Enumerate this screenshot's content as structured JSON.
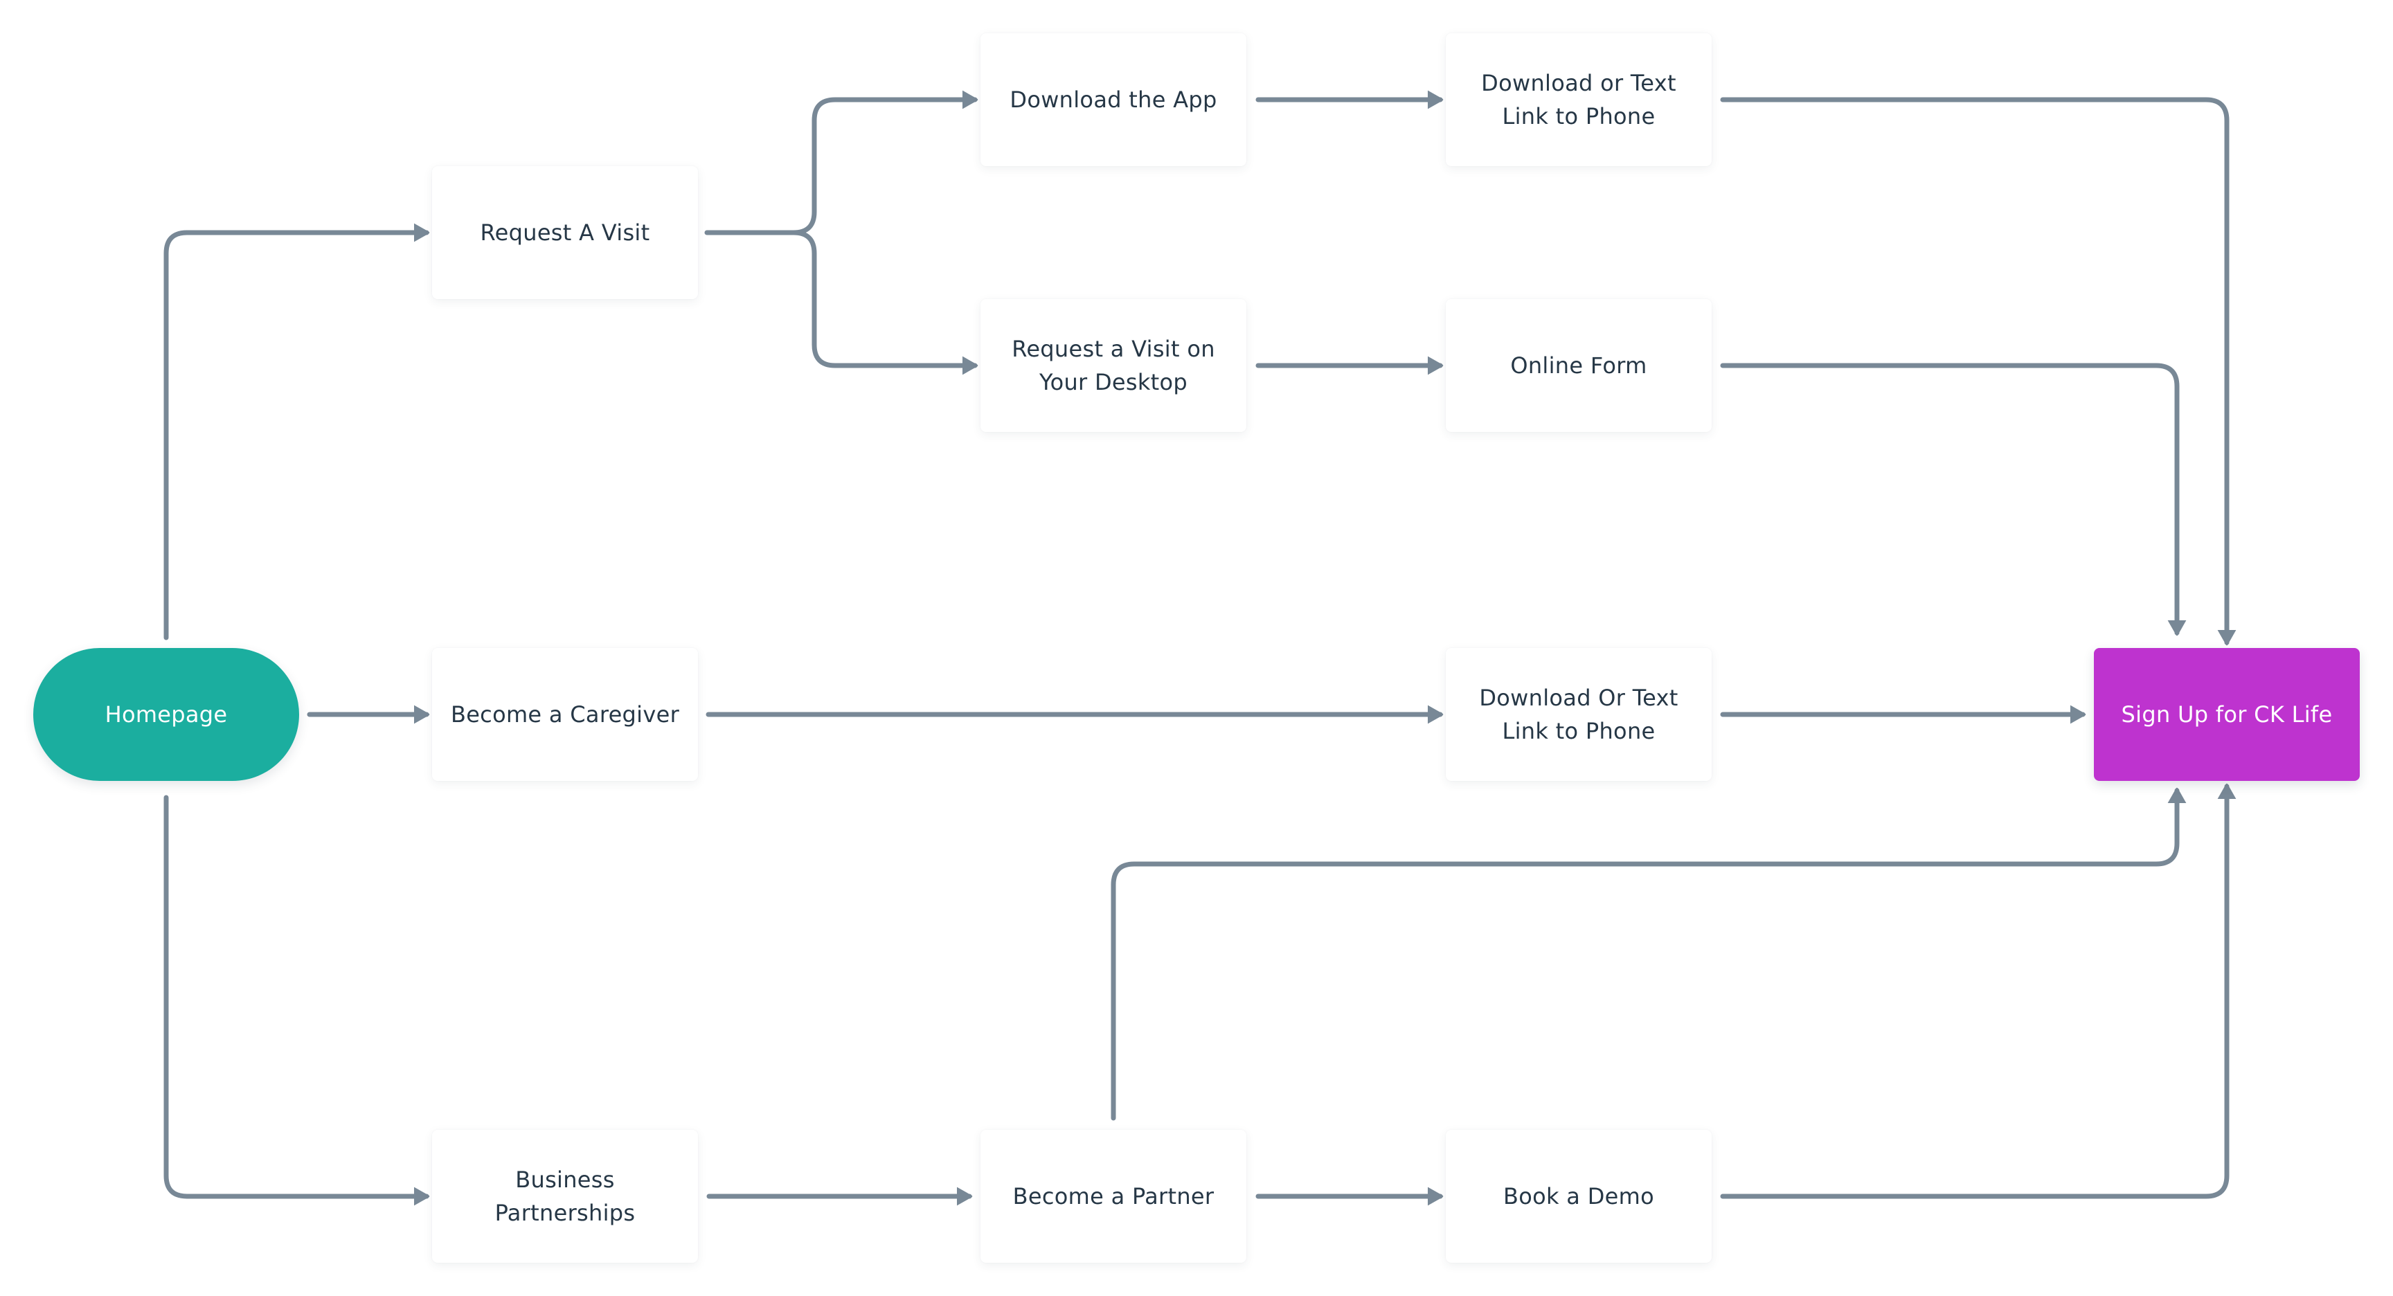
{
  "colors": {
    "start_fill": "#1BAE9F",
    "end_fill": "#BE33CF",
    "node_fill": "#FFFFFF",
    "node_text": "#263746",
    "edge": "#788896"
  },
  "nodes": {
    "homepage": {
      "label": "Homepage",
      "kind": "start"
    },
    "request_visit": {
      "label": "Request A Visit",
      "kind": "step"
    },
    "download_app": {
      "label": "Download the App",
      "kind": "step"
    },
    "download_text_link_1": {
      "label": "Download or Text\nLink to Phone",
      "kind": "step"
    },
    "request_visit_desktop": {
      "label": "Request a Visit on\nYour Desktop",
      "kind": "step"
    },
    "online_form": {
      "label": "Online Form",
      "kind": "step"
    },
    "become_caregiver": {
      "label": "Become a Caregiver",
      "kind": "step"
    },
    "download_text_link_2": {
      "label": "Download Or Text\nLink to Phone",
      "kind": "step"
    },
    "sign_up": {
      "label": "Sign Up for CK Life",
      "kind": "end"
    },
    "business_partnerships": {
      "label": "Business\nPartnerships",
      "kind": "step"
    },
    "become_partner": {
      "label": "Become a Partner",
      "kind": "step"
    },
    "book_demo": {
      "label": "Book a Demo",
      "kind": "step"
    }
  },
  "edges": [
    {
      "from": "homepage",
      "to": "request_visit"
    },
    {
      "from": "homepage",
      "to": "become_caregiver"
    },
    {
      "from": "homepage",
      "to": "business_partnerships"
    },
    {
      "from": "request_visit",
      "to": "download_app"
    },
    {
      "from": "request_visit",
      "to": "request_visit_desktop"
    },
    {
      "from": "download_app",
      "to": "download_text_link_1"
    },
    {
      "from": "request_visit_desktop",
      "to": "online_form"
    },
    {
      "from": "download_text_link_1",
      "to": "sign_up"
    },
    {
      "from": "online_form",
      "to": "sign_up"
    },
    {
      "from": "become_caregiver",
      "to": "download_text_link_2"
    },
    {
      "from": "download_text_link_2",
      "to": "sign_up"
    },
    {
      "from": "business_partnerships",
      "to": "become_partner"
    },
    {
      "from": "become_partner",
      "to": "book_demo"
    },
    {
      "from": "become_partner",
      "to": "sign_up"
    },
    {
      "from": "book_demo",
      "to": "sign_up"
    }
  ]
}
